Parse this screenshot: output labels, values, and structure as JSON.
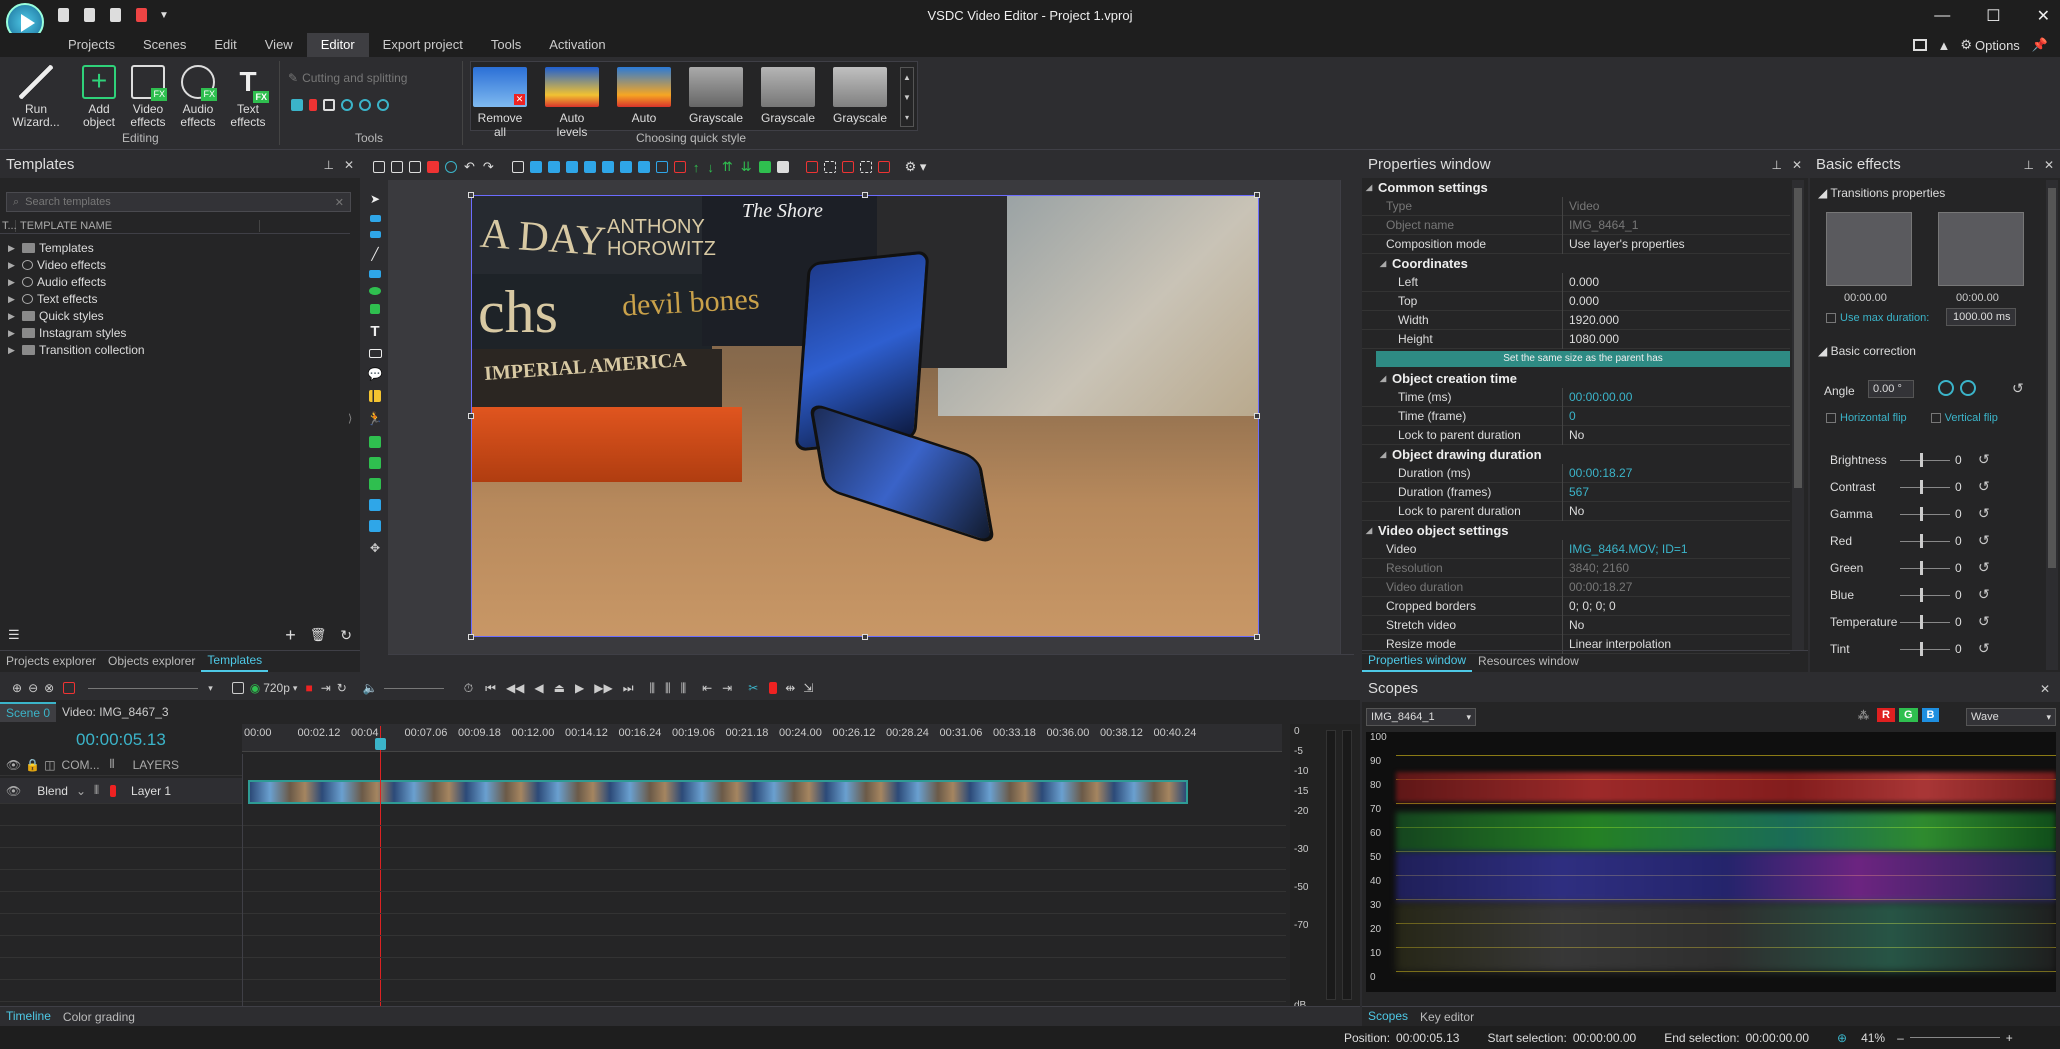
{
  "app": {
    "title": "VSDC Video Editor - Project 1.vproj",
    "options_label": "Options"
  },
  "menu": [
    "Projects",
    "Scenes",
    "Edit",
    "View",
    "Editor",
    "Export project",
    "Tools",
    "Activation"
  ],
  "menu_active": "Editor",
  "ribbon": {
    "editing_group": "Editing",
    "tools_group": "Tools",
    "quick_style_group": "Choosing quick style",
    "buttons": {
      "run_wizard": "Run Wizard...",
      "add_object": "Add object",
      "video_effects": "Video effects",
      "audio_effects": "Audio effects",
      "text_effects": "Text effects"
    },
    "cutting_label": "Cutting and splitting",
    "styles": [
      "Remove all",
      "Auto levels",
      "Auto",
      "Grayscale",
      "Grayscale",
      "Grayscale"
    ]
  },
  "templates": {
    "title": "Templates",
    "search_placeholder": "Search templates",
    "col_t": "T...",
    "col_name": "TEMPLATE NAME",
    "items": [
      "Templates",
      "Video effects",
      "Audio effects",
      "Text effects",
      "Quick styles",
      "Instagram styles",
      "Transition collection"
    ],
    "tabs": [
      "Projects explorer",
      "Objects explorer",
      "Templates"
    ],
    "active_tab": "Templates"
  },
  "properties": {
    "title": "Properties window",
    "common_settings": "Common settings",
    "type_k": "Type",
    "type_v": "Video",
    "objname_k": "Object name",
    "objname_v": "IMG_8464_1",
    "comp_k": "Composition mode",
    "comp_v": "Use layer's properties",
    "coordinates": "Coordinates",
    "left_k": "Left",
    "left_v": "0.000",
    "top_k": "Top",
    "top_v": "0.000",
    "width_k": "Width",
    "width_v": "1920.000",
    "height_k": "Height",
    "height_v": "1080.000",
    "same_size_btn": "Set the same size as the parent has",
    "creation_time": "Object creation time",
    "time_ms_k": "Time (ms)",
    "time_ms_v": "00:00:00.00",
    "time_fr_k": "Time (frame)",
    "time_fr_v": "0",
    "lock1_k": "Lock to parent duration",
    "lock1_v": "No",
    "drawing_duration": "Object drawing duration",
    "dur_ms_k": "Duration (ms)",
    "dur_ms_v": "00:00:18.27",
    "dur_fr_k": "Duration (frames)",
    "dur_fr_v": "567",
    "lock2_k": "Lock to parent duration",
    "lock2_v": "No",
    "video_settings": "Video object settings",
    "video_k": "Video",
    "video_v": "IMG_8464.MOV; ID=1",
    "res_k": "Resolution",
    "res_v": "3840; 2160",
    "vdur_k": "Video duration",
    "vdur_v": "00:00:18.27",
    "crop_k": "Cropped borders",
    "crop_v": "0; 0; 0; 0",
    "stretch_k": "Stretch video",
    "stretch_v": "No",
    "resize_k": "Resize mode",
    "resize_v": "Linear interpolation",
    "tabs": [
      "Properties window",
      "Resources window"
    ]
  },
  "effects": {
    "title": "Basic effects",
    "transitions": "Transitions properties",
    "t1": "00:00.00",
    "t2": "00:00.00",
    "use_max": "Use max duration:",
    "max_val": "1000.00 ms",
    "basic_correction": "Basic correction",
    "angle_label": "Angle",
    "angle_val": "0.00 °",
    "hflip": "Horizontal flip",
    "vflip": "Vertical flip",
    "sliders": [
      {
        "label": "Brightness",
        "value": "0"
      },
      {
        "label": "Contrast",
        "value": "0"
      },
      {
        "label": "Gamma",
        "value": "0"
      },
      {
        "label": "Red",
        "value": "0"
      },
      {
        "label": "Green",
        "value": "0"
      },
      {
        "label": "Blue",
        "value": "0"
      },
      {
        "label": "Temperature",
        "value": "0"
      },
      {
        "label": "Tint",
        "value": "0"
      }
    ]
  },
  "timeline": {
    "zoom": "720p",
    "scene_tab": "Scene 0",
    "video_tab": "Video: IMG_8467_3",
    "current_time": "00:00:05.13",
    "com_label": "COM...",
    "layers_label": "LAYERS",
    "blend_label": "Blend",
    "layer1_label": "Layer 1",
    "ruler": [
      "00:00",
      "00:02.12",
      "00:04",
      "00:07.06",
      "00:09.18",
      "00:12.00",
      "00:14.12",
      "00:16.24",
      "00:19.06",
      "00:21.18",
      "00:24.00",
      "00:26.12",
      "00:28.24",
      "00:31.06",
      "00:33.18",
      "00:36.00",
      "00:38.12",
      "00:40.24"
    ],
    "db_scale": [
      "0",
      "-5",
      "-10",
      "-15",
      "-20",
      "-30",
      "-50",
      "-70",
      "dB"
    ],
    "bottom_tabs": [
      "Timeline",
      "Color grading"
    ]
  },
  "scopes": {
    "title": "Scopes",
    "object_select": "IMG_8464_1",
    "mode": "Wave",
    "channels": [
      "R",
      "G",
      "B"
    ],
    "y_axis": [
      "100",
      "90",
      "80",
      "70",
      "60",
      "50",
      "40",
      "30",
      "20",
      "10",
      "0"
    ],
    "tabs": [
      "Scopes",
      "Key editor"
    ]
  },
  "status": {
    "position_label": "Position:",
    "position": "00:00:05.13",
    "start_label": "Start selection:",
    "start": "00:00:00.00",
    "end_label": "End selection:",
    "end": "00:00:00.00",
    "zoom": "41%"
  },
  "preview": {
    "book_texts": [
      "A DAY",
      "ANTHONY HOROWITZ",
      "devil bones",
      "IMPERIAL AMERICA",
      "The Shore",
      "chs"
    ]
  },
  "colors": {
    "accent": "#3bb4c9",
    "teal_button": "#2e8b84",
    "red": "#e02020",
    "green": "#2fbf4f",
    "blue": "#1e8fe0"
  }
}
